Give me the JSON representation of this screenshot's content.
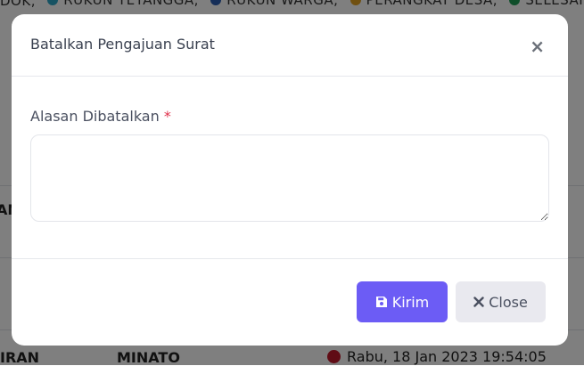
{
  "background": {
    "legend": [
      {
        "label": "DOK,",
        "color": "#999999"
      },
      {
        "label": "RUKUN TETANGGA,",
        "color": "#2fa6c7"
      },
      {
        "label": "RUKUN WARGA,",
        "color": "#2a5db0"
      },
      {
        "label": "PERANGKAT DESA,",
        "color": "#e0a020"
      },
      {
        "label": "SELESAI,",
        "color": "#1f9d55"
      }
    ],
    "row_cut_text": "AN",
    "row": {
      "col1": "IRAN",
      "col2": "MINATO",
      "status_color": "#c0182b",
      "date": "Rabu, 18 Jan 2023 19:54:05"
    }
  },
  "modal": {
    "title": "Batalkan Pengajuan Surat",
    "close_symbol": "×",
    "field": {
      "label": "Alasan Dibatalkan",
      "required_mark": "*",
      "value": "",
      "placeholder": ""
    },
    "buttons": {
      "submit_label": "Kirim",
      "close_label": "Close"
    },
    "colors": {
      "primary": "#6c5cf5",
      "secondary": "#e9e9ef",
      "required": "#e0314b"
    }
  }
}
